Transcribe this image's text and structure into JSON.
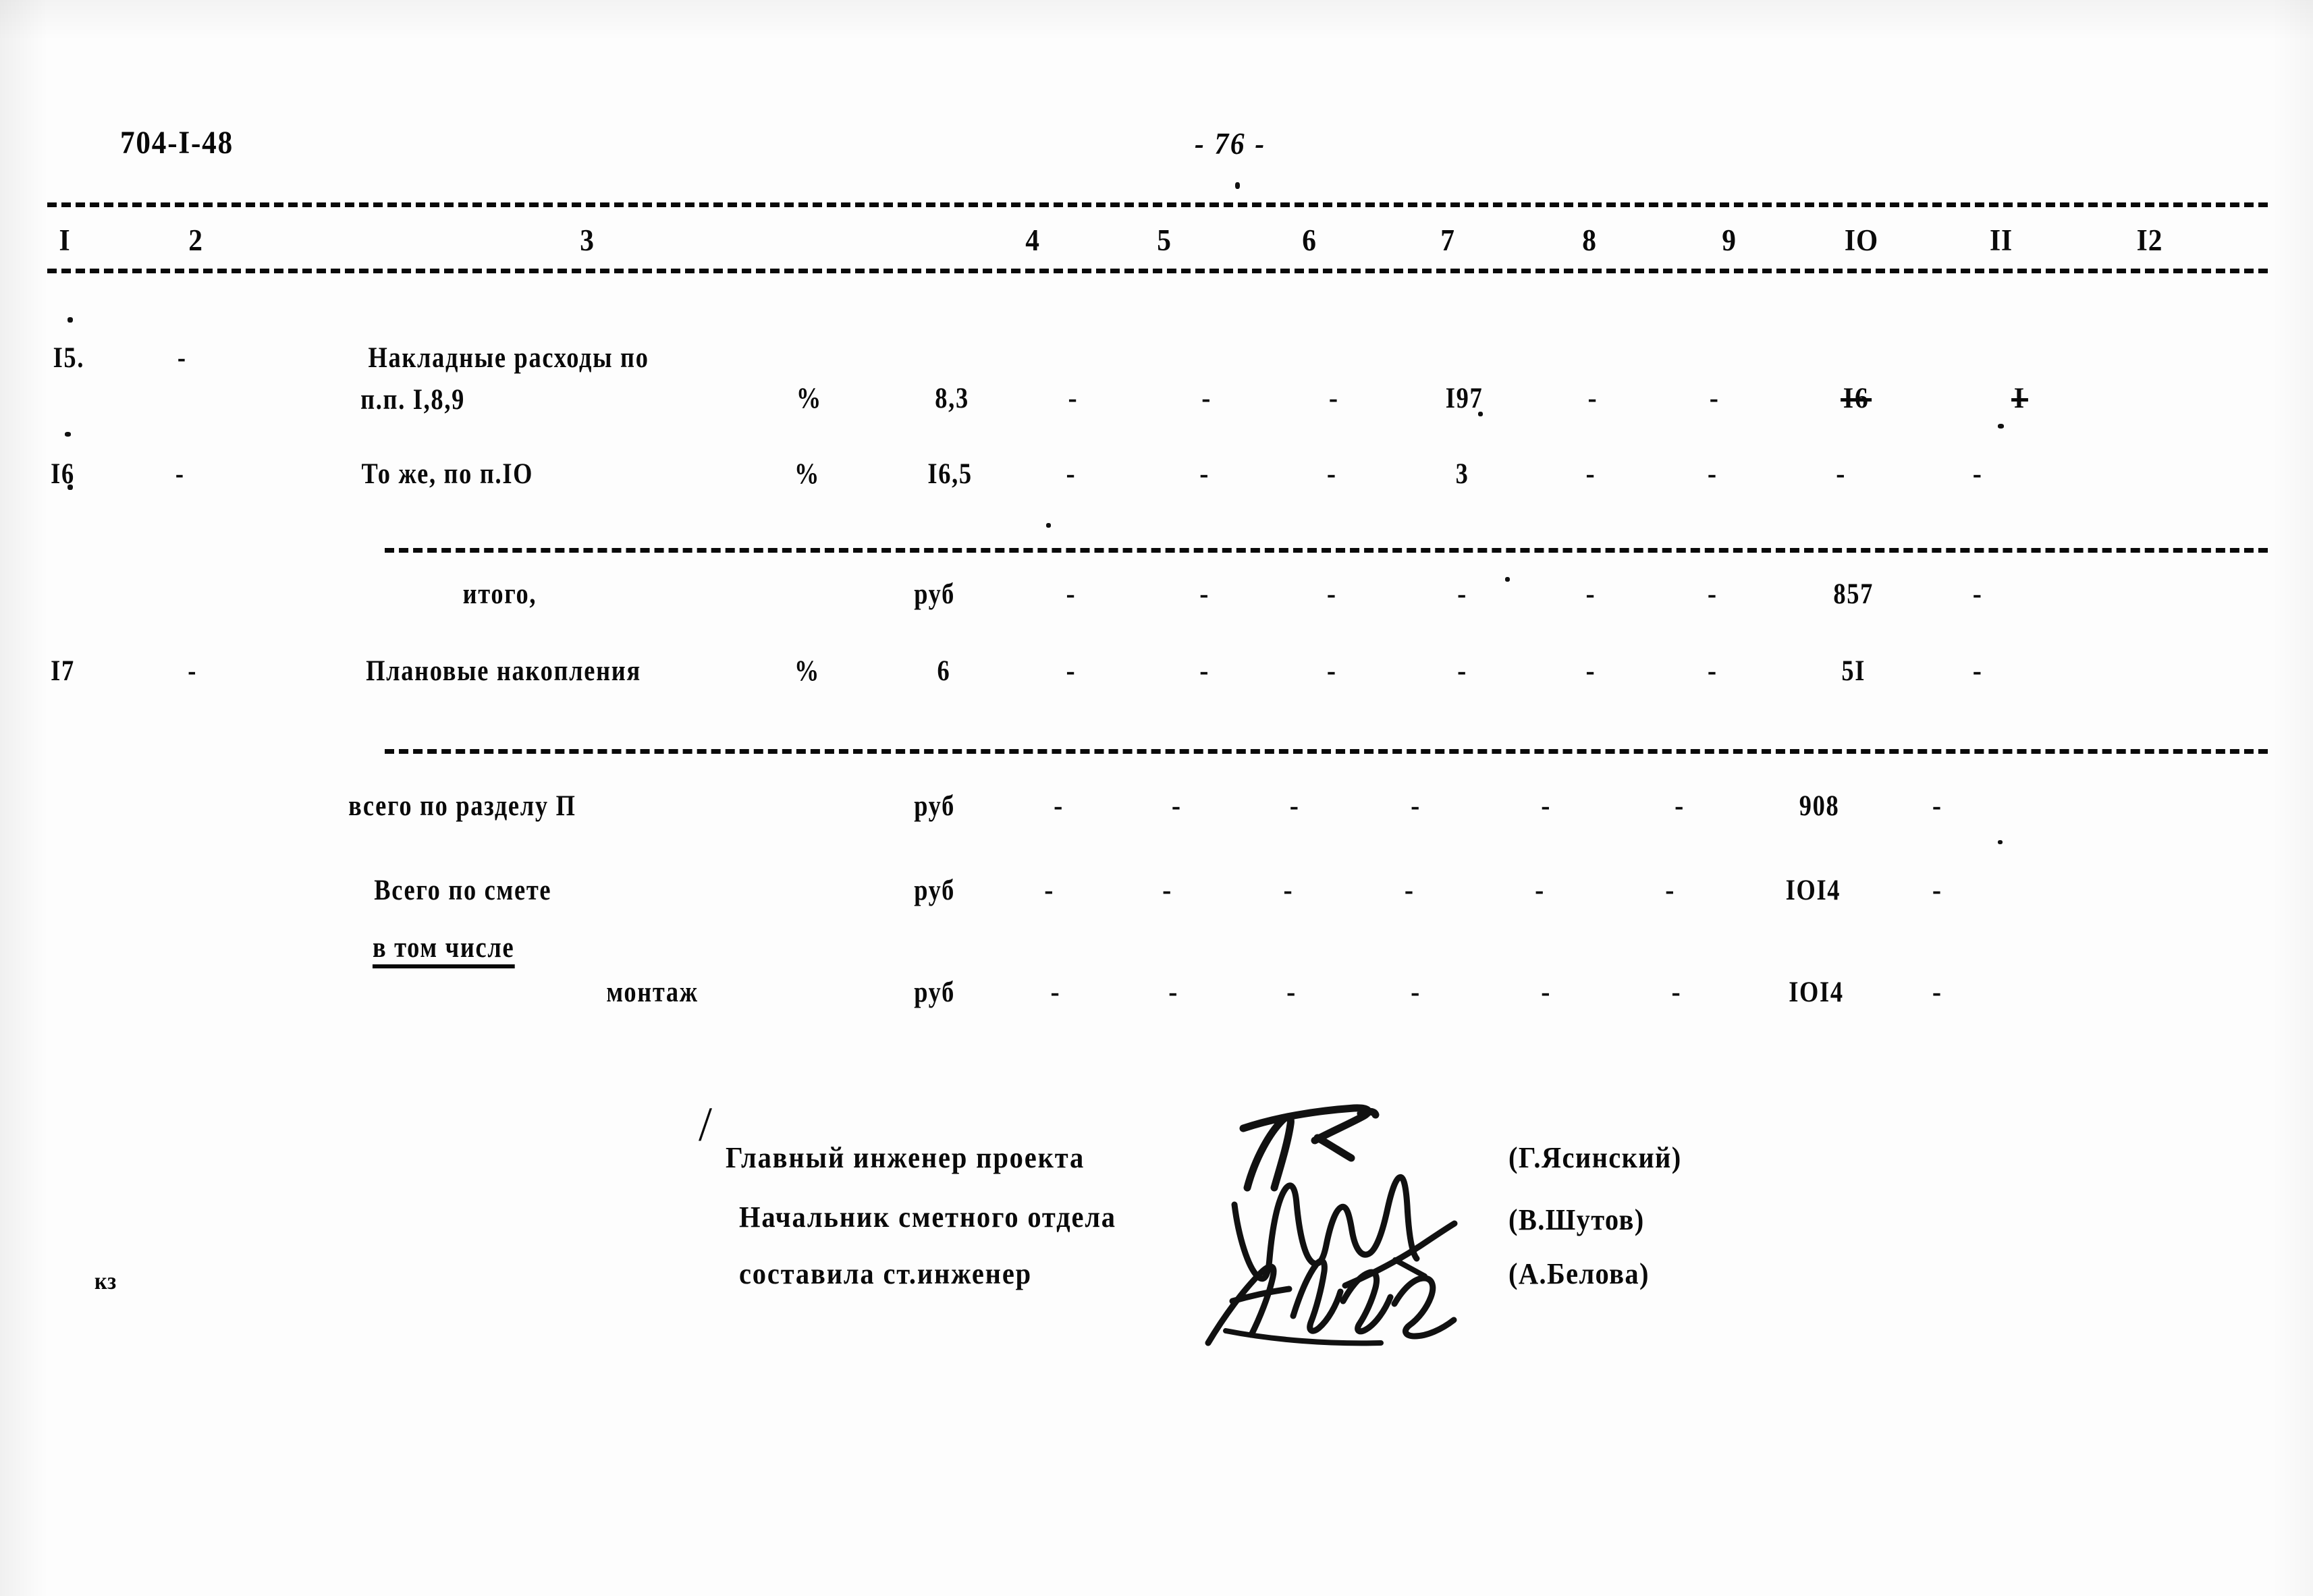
{
  "document": {
    "code": "704-I-48",
    "page_number": "- 76 -",
    "corner_mark": "кз"
  },
  "table": {
    "column_headers": [
      "I",
      "2",
      "3",
      "4",
      "5",
      "6",
      "7",
      "8",
      "9",
      "IO",
      "II",
      "I2"
    ],
    "rows": [
      {
        "no": "I5.",
        "col2": "-",
        "name_line1": "Накладные расходы по",
        "name_line2": "п.п. I,8,9",
        "unit": "%",
        "col4": "8,3",
        "col5": "-",
        "col6": "-",
        "col7": "-",
        "col8": "I97",
        "col9": "-",
        "col10": "-",
        "col11": "I6",
        "col11_struck": true,
        "col12": "I",
        "col12_struck": true
      },
      {
        "no": "I6",
        "col2": "-",
        "name_line1": "То же, по п.IO",
        "name_line2": "",
        "unit": "%",
        "col4": "I6,5",
        "col5": "-",
        "col6": "-",
        "col7": "-",
        "col8": "3",
        "col9": "-",
        "col10": "-",
        "col11": "-",
        "col11_struck": false,
        "col12": "-",
        "col12_struck": false
      },
      {
        "no": "",
        "col2": "",
        "name_line1": "итого,",
        "name_line2": "",
        "unit": "руб",
        "col4": "-",
        "col5": "-",
        "col6": "-",
        "col7": "-",
        "col8": "-",
        "col9": "-",
        "col10": "-",
        "col11": "857",
        "col11_struck": false,
        "col12": "-",
        "col12_struck": false
      },
      {
        "no": "I7",
        "col2": "-",
        "name_line1": "Плановые накопления",
        "name_line2": "",
        "unit": "%",
        "col4": "6",
        "col5": "-",
        "col6": "-",
        "col7": "-",
        "col8": "-",
        "col9": "-",
        "col10": "-",
        "col11": "5I",
        "col11_struck": false,
        "col12": "-",
        "col12_struck": false
      },
      {
        "no": "",
        "col2": "",
        "name_line1": "всего по разделу П",
        "name_line2": "",
        "unit": "руб",
        "col4": "-",
        "col5": "-",
        "col6": "-",
        "col7": "-",
        "col8": "-",
        "col9": "-",
        "col10": "-",
        "col11": "908",
        "col11_struck": false,
        "col12": "-",
        "col12_struck": false
      },
      {
        "no": "",
        "col2": "",
        "name_line1": "Всего по смете",
        "name_line2": "",
        "unit": "руб",
        "col4": "-",
        "col5": "-",
        "col6": "-",
        "col7": "-",
        "col8": "-",
        "col9": "-",
        "col10": "-",
        "col11": "IOI4",
        "col11_struck": false,
        "col12": "-",
        "col12_struck": false
      },
      {
        "no": "",
        "col2": "",
        "name_line1": "в том числе",
        "name_line2": "",
        "unit": "",
        "col4": "",
        "col5": "",
        "col6": "",
        "col7": "",
        "col8": "",
        "col9": "",
        "col10": "",
        "col11": "",
        "col11_struck": false,
        "col12": "",
        "col12_struck": false
      },
      {
        "no": "",
        "col2": "",
        "name_line1": "монтаж",
        "name_line2": "",
        "unit": "руб",
        "col4": "-",
        "col5": "-",
        "col6": "-",
        "col7": "-",
        "col8": "-",
        "col9": "-",
        "col10": "-",
        "col11": "IOI4",
        "col11_struck": false,
        "col12": "-",
        "col12_struck": false
      }
    ]
  },
  "signatures": [
    {
      "title": "Главный инженер проекта",
      "name": "(Г.Ясинский)"
    },
    {
      "title": "Начальник сметного отдела",
      "name": "(В.Шутов)"
    },
    {
      "title": "составила ст.инженер",
      "name": "(А.Белова)"
    }
  ]
}
